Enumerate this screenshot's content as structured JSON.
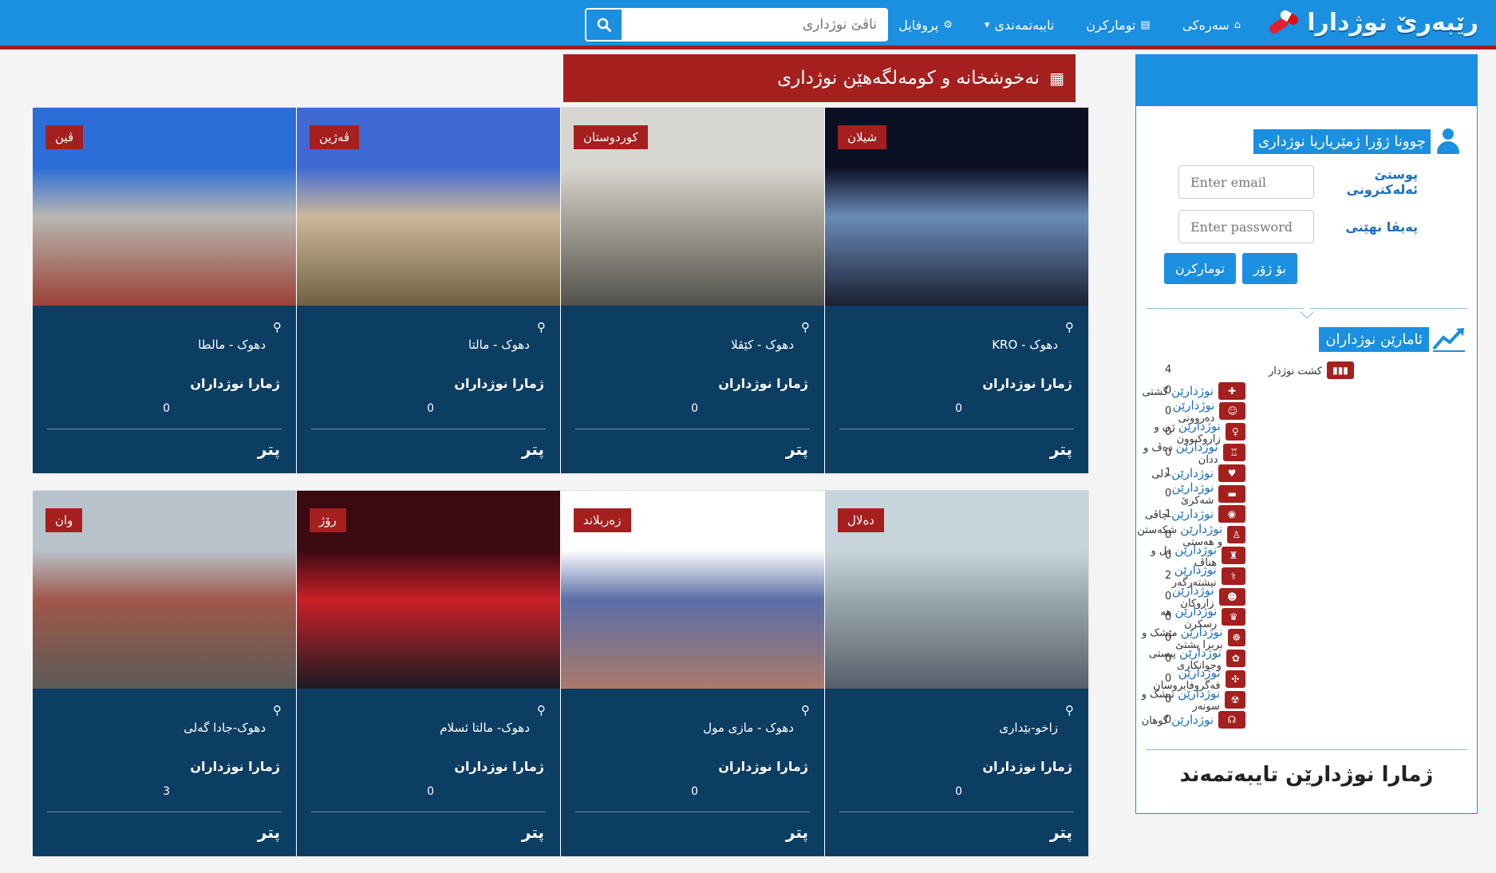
{
  "nav": {
    "brand": "رێبەرێ نوژدارا",
    "links": [
      {
        "label": "سەرەکی",
        "icon": "⌂"
      },
      {
        "label": "تومارکرن",
        "icon": "▤"
      },
      {
        "label": "تایبەتمەندی",
        "icon": "▾"
      },
      {
        "label": "پروفایل",
        "icon": "⚙"
      }
    ],
    "search_placeholder": "ناڤێ نوژداری"
  },
  "section_title": "نەخوشخانە و کومەلگەهێن نوژداری",
  "cards": [
    {
      "badge": "شیلان",
      "address": "دهوک - KRO",
      "label": "ژمارا نوژداران",
      "count": "0",
      "more": "پتر",
      "colors": [
        "#0a0f24",
        "#6a8bb8",
        "#1a2132"
      ]
    },
    {
      "badge": "کوردوستان",
      "address": "دهوک - کێڤلا",
      "label": "ژمارا نوژداران",
      "count": "0",
      "more": "پتر",
      "colors": [
        "#d8d6d0",
        "#aaa59a",
        "#52524d"
      ]
    },
    {
      "badge": "ڤەژین",
      "address": "دهوک - مالتا",
      "label": "ژمارا نوژداران",
      "count": "0",
      "more": "پتر",
      "colors": [
        "#3f6ad4",
        "#cdb89a",
        "#6f6141"
      ]
    },
    {
      "badge": "ڤین",
      "address": "دهوک - مالطا",
      "label": "ژمارا نوژداران",
      "count": "0",
      "more": "پتر",
      "colors": [
        "#2c6ed8",
        "#b9b6b1",
        "#9b4236"
      ]
    },
    {
      "badge": "دەلال",
      "address": "زاخو-بێداری",
      "label": "ژمارا نوژداران",
      "count": "0",
      "more": "پتر",
      "colors": [
        "#c8d4dc",
        "#9aa6ae",
        "#56606a"
      ]
    },
    {
      "badge": "زەربلاند",
      "address": "دهوک - مازی مول",
      "label": "ژمارا نوژداران",
      "count": "0",
      "more": "پتر",
      "colors": [
        "#ffffff",
        "#5a6ea8",
        "#aa7a6a"
      ]
    },
    {
      "badge": "رۆژ",
      "address": "دهوک- مالتا ئسلام",
      "label": "ژمارا نوژداران",
      "count": "0",
      "more": "پتر",
      "colors": [
        "#3a0a10",
        "#c92028",
        "#1c1c22"
      ]
    },
    {
      "badge": "وان",
      "address": "دهوک-جادا گەلی",
      "label": "ژمارا نوژداران",
      "count": "3",
      "more": "پتر",
      "colors": [
        "#b9c3cc",
        "#a0584a",
        "#5d5a58"
      ]
    }
  ],
  "sidebar": {
    "login_title": "چوونا ژۆرا ژمێریاریا نوژداری",
    "email_label": "پوستێ ئەلەکترونی",
    "email_placeholder": "Enter email",
    "password_label": "پەیڤا نهێنی",
    "password_placeholder": "Enter password",
    "login_button": "بۆ ژۆر",
    "register_button": "تومارکرن",
    "stats_title": "ئامارێن نوژداران",
    "stats": [
      {
        "prefix": "",
        "name": "کشت نوژدار",
        "count": "4",
        "icon": "▮▮▮"
      },
      {
        "prefix": "نوژدارێن",
        "name": "گشتی",
        "count": "0",
        "icon": "✚"
      },
      {
        "prefix": "نوژدارێن",
        "name": "دەروونی",
        "count": "0",
        "icon": "☺"
      },
      {
        "prefix": "نوژدارێن",
        "name": "ژن و زاروکبوون",
        "count": "0",
        "icon": "♀"
      },
      {
        "prefix": "نوژدارێن",
        "name": "دەڤ و ددان",
        "count": "0",
        "icon": "♖"
      },
      {
        "prefix": "نوژدارێن",
        "name": "دلی",
        "count": "1",
        "icon": "♥"
      },
      {
        "prefix": "نوژدارێن",
        "name": "شەکرێ",
        "count": "0",
        "icon": "▬"
      },
      {
        "prefix": "نوژدارێن",
        "name": "چاڤی",
        "count": "1",
        "icon": "◉"
      },
      {
        "prefix": "نوژدارێن",
        "name": "شکەستن و هەستی",
        "count": "0",
        "icon": "♙"
      },
      {
        "prefix": "نوژدارێن",
        "name": "دل و هناڤ",
        "count": "0",
        "icon": "♜"
      },
      {
        "prefix": "نوژدارێن",
        "name": "نیشتەرگەر",
        "count": "2",
        "icon": "⚕"
      },
      {
        "prefix": "نوژدارێن",
        "name": "زاروکان",
        "count": "0",
        "icon": "☻"
      },
      {
        "prefix": "نوژدارێن",
        "name": "هە رسکرن",
        "count": "0",
        "icon": "♛"
      },
      {
        "prefix": "نوژدارێن",
        "name": "مێشک و بربرا پشتێ",
        "count": "0",
        "icon": "☸"
      },
      {
        "prefix": "نوژدارێن",
        "name": "پیستی وجوانکاری",
        "count": "0",
        "icon": "✿"
      },
      {
        "prefix": "نوژدارێن",
        "name": "فەگروفایروسان",
        "count": "0",
        "icon": "✣"
      },
      {
        "prefix": "نوژدارێن",
        "name": "تیشک و سونەر",
        "count": "0",
        "icon": "☢"
      },
      {
        "prefix": "نوژدارێن",
        "name": "گوهان",
        "count": "0",
        "icon": "☊"
      }
    ],
    "specialty_title": "ژمارا نوژدارێن تایبەتمەند"
  }
}
